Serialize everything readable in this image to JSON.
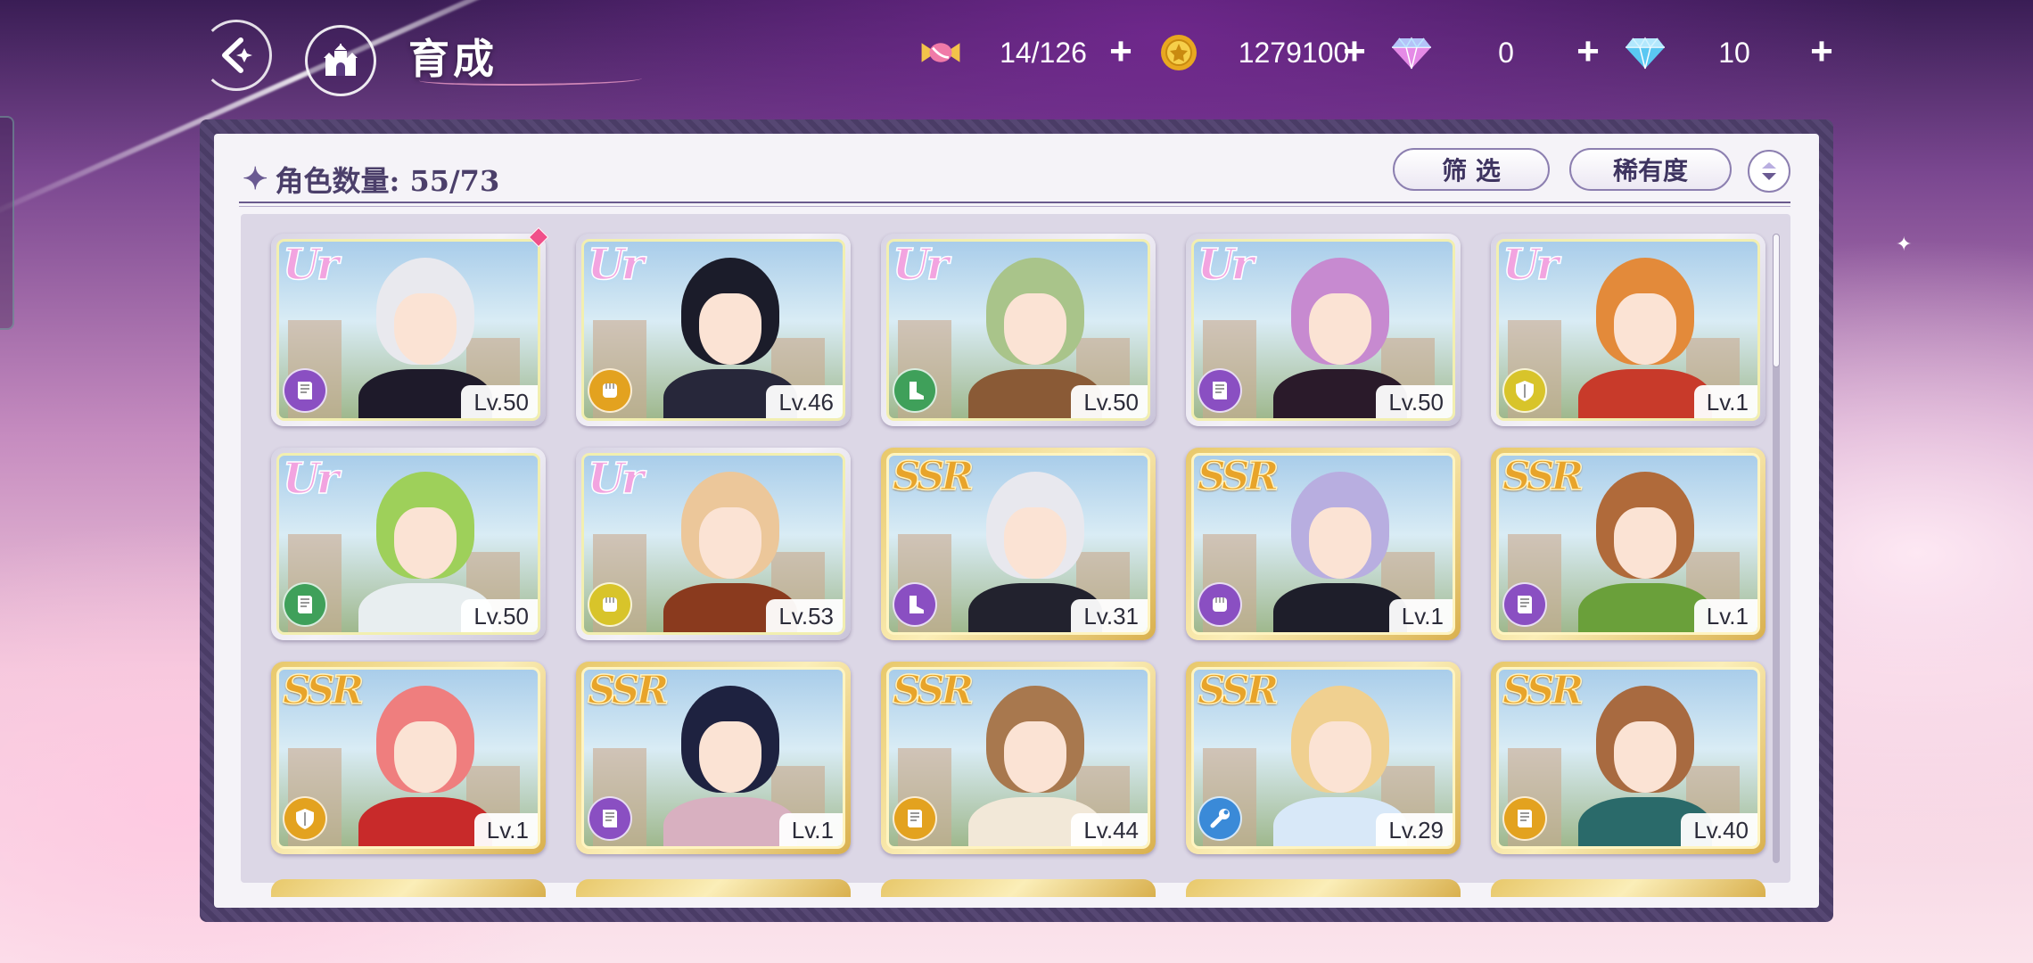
{
  "header": {
    "title": "育成"
  },
  "currencies": [
    {
      "name": "candy",
      "icon": "candy-icon",
      "value": "14/126"
    },
    {
      "name": "coin",
      "icon": "coin-icon",
      "value": "1279100"
    },
    {
      "name": "pink-gem",
      "icon": "pink-gem-icon",
      "value": "0"
    },
    {
      "name": "blue-gem",
      "icon": "blue-gem-icon",
      "value": "10"
    }
  ],
  "panel": {
    "count_label": "角色数量: 55/73",
    "filter_label": "筛 选",
    "sort_label": "稀有度"
  },
  "characters": [
    {
      "rarity": "UR",
      "level": "Lv.50",
      "class": "book",
      "class_color": "#8a4fc2",
      "hair": "#e9e9ee",
      "outfit": "#1e1a2a",
      "new": true
    },
    {
      "rarity": "UR",
      "level": "Lv.46",
      "class": "fist",
      "class_color": "#e3a21f",
      "hair": "#1b1c2a",
      "outfit": "#27273a",
      "new": false
    },
    {
      "rarity": "UR",
      "level": "Lv.50",
      "class": "boot",
      "class_color": "#3fa05a",
      "hair": "#a9c48a",
      "outfit": "#8a5a36",
      "new": false
    },
    {
      "rarity": "UR",
      "level": "Lv.50",
      "class": "book",
      "class_color": "#8a4fc2",
      "hair": "#c78ad0",
      "outfit": "#2a1a2a",
      "new": false
    },
    {
      "rarity": "UR",
      "level": "Lv.1",
      "class": "shield",
      "class_color": "#d8c42a",
      "hair": "#e38a3a",
      "outfit": "#c83a2a",
      "new": false
    },
    {
      "rarity": "UR",
      "level": "Lv.50",
      "class": "book",
      "class_color": "#3fa05a",
      "hair": "#9ed05a",
      "outfit": "#e8eef0",
      "new": false
    },
    {
      "rarity": "UR",
      "level": "Lv.53",
      "class": "fist",
      "class_color": "#d8c42a",
      "hair": "#ecc79a",
      "outfit": "#8a3a1e",
      "new": false
    },
    {
      "rarity": "SSR",
      "level": "Lv.31",
      "class": "boot",
      "class_color": "#8a4fc2",
      "hair": "#e8e8ee",
      "outfit": "#22222e",
      "new": false
    },
    {
      "rarity": "SSR",
      "level": "Lv.1",
      "class": "fist",
      "class_color": "#8a4fc2",
      "hair": "#b8aee0",
      "outfit": "#1e1e2a",
      "new": false
    },
    {
      "rarity": "SSR",
      "level": "Lv.1",
      "class": "book",
      "class_color": "#8a4fc2",
      "hair": "#b06a3a",
      "outfit": "#6aa03a",
      "new": false
    },
    {
      "rarity": "SSR",
      "level": "Lv.1",
      "class": "shield",
      "class_color": "#e3a21f",
      "hair": "#ef7e7e",
      "outfit": "#c82a2a",
      "new": false
    },
    {
      "rarity": "SSR",
      "level": "Lv.1",
      "class": "book",
      "class_color": "#8a4fc2",
      "hair": "#1e2240",
      "outfit": "#d8b0c0",
      "new": false
    },
    {
      "rarity": "SSR",
      "level": "Lv.44",
      "class": "book",
      "class_color": "#e3a21f",
      "hair": "#a8784e",
      "outfit": "#f2e8d8",
      "new": false
    },
    {
      "rarity": "SSR",
      "level": "Lv.29",
      "class": "wrench",
      "class_color": "#3a8ad8",
      "hair": "#f0d090",
      "outfit": "#d8e8f8",
      "new": false
    },
    {
      "rarity": "SSR",
      "level": "Lv.40",
      "class": "book",
      "class_color": "#e3a21f",
      "hair": "#a86a40",
      "outfit": "#2a6a6a",
      "new": false
    }
  ]
}
